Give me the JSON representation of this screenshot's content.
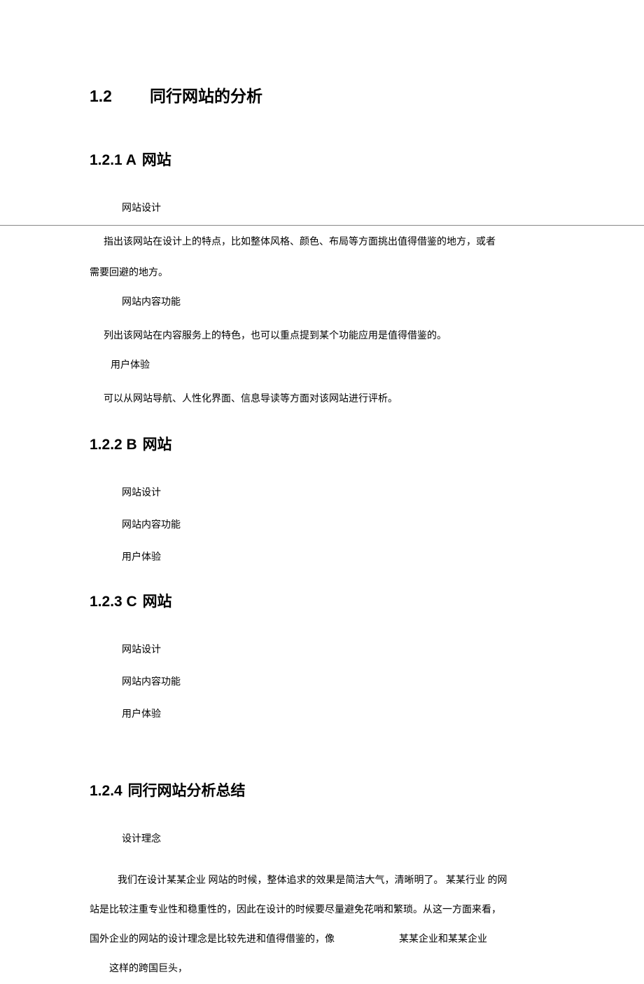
{
  "title": {
    "num": "1.2",
    "text": "同行网站的分析"
  },
  "sec121": {
    "num": "1.2.1 A",
    "text": "网站",
    "sub1": "网站设计",
    "body1a": "指出该网站在设计上的特点，比如整体风格、颜色、布局等方面挑出值得借鉴的地方，或者",
    "body1b": "需要回避的地方。",
    "sub2": "网站内容功能",
    "body2": "列出该网站在内容服务上的特色，也可以重点提到某个功能应用是值得借鉴的。",
    "sub3": "用户体验",
    "body3": "可以从网站导航、人性化界面、信息导读等方面对该网站进行评析。"
  },
  "sec122": {
    "num": "1.2.2 B",
    "text": "网站",
    "sub1": "网站设计",
    "sub2": "网站内容功能",
    "sub3": "用户体验"
  },
  "sec123": {
    "num": "1.2.3 C",
    "text": "网站",
    "sub1": "网站设计",
    "sub2": "网站内容功能",
    "sub3": "用户体验"
  },
  "sec124": {
    "num": "1.2.4",
    "text": "同行网站分析总结",
    "sub1": "设计理念",
    "p1": "我们在设计某某企业 网站的时候，整体追求的效果是简洁大气，清晰明了。 某某行业 的网",
    "p2": "站是比较注重专业性和稳重性的，因此在设计的时候要尽量避免花哨和繁琐。从这一方面来看，",
    "p3a": "国外企业的网站的设计理念是比较先进和值得借鉴的，像",
    "p3b": "某某企业和某某企业",
    "p3c": "这样的跨国巨头，"
  }
}
